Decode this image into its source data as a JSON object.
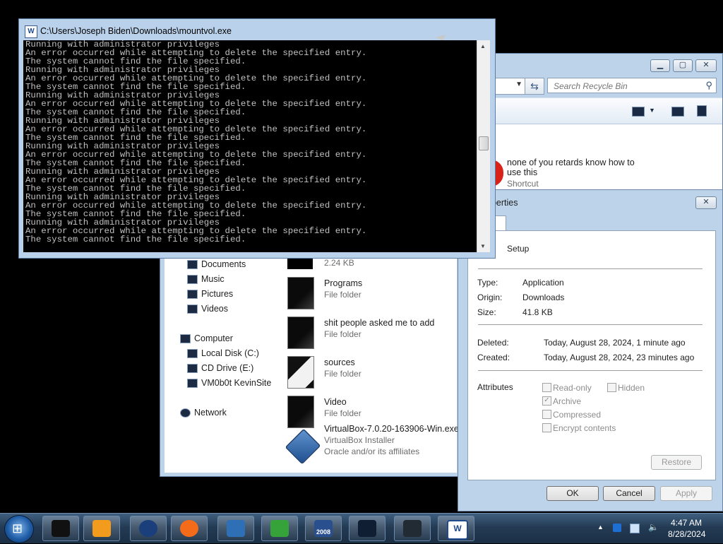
{
  "explorer": {
    "search_placeholder": "Search Recycle Bin",
    "shortcut": {
      "name_line1": "none of you retards know how to",
      "name_line2": "use this",
      "type": "Shortcut"
    },
    "nav": [
      {
        "label": "Documents"
      },
      {
        "label": "Music"
      },
      {
        "label": "Pictures"
      },
      {
        "label": "Videos"
      },
      {
        "label": "Computer"
      },
      {
        "label": "Local Disk (C:)"
      },
      {
        "label": "CD Drive (E:)"
      },
      {
        "label": "VM0b0t KevinSite"
      },
      {
        "label": "Network"
      }
    ],
    "files": [
      {
        "name": "",
        "sub": "2.24 KB"
      },
      {
        "name": "Programs",
        "sub": "File folder"
      },
      {
        "name": "shit people asked me to add",
        "sub": "File folder"
      },
      {
        "name": "sources",
        "sub": "File folder"
      },
      {
        "name": "Video",
        "sub": "File folder"
      },
      {
        "name": "VirtualBox-7.0.20-163906-Win.exe",
        "sub": "VirtualBox Installer",
        "sub2": "Oracle and/or its affiliates"
      }
    ]
  },
  "props": {
    "title": "operties",
    "tab": "al",
    "name": "Setup",
    "type_label": "Type:",
    "type_value": "Application",
    "origin_label": "Origin:",
    "origin_value": "Downloads",
    "size_label": "Size:",
    "size_value": "41.8 KB",
    "deleted_label": "Deleted:",
    "deleted_value": "Today, August 28, 2024, 1 minute ago",
    "created_label": "Created:",
    "created_value": "Today, August 28, 2024, 23 minutes ago",
    "attributes_label": "Attributes",
    "attrs": {
      "readonly": "Read-only",
      "hidden": "Hidden",
      "archive": "Archive",
      "compressed": "Compressed",
      "encrypt": "Encrypt contents"
    },
    "restore": "Restore",
    "ok": "OK",
    "cancel": "Cancel",
    "apply": "Apply"
  },
  "console": {
    "title": "C:\\Users\\Joseph Biden\\Downloads\\mountvol.exe",
    "lines": [
      "Running with administrator privileges",
      "An error occurred while attempting to delete the specified entry.",
      "The system cannot find the file specified.",
      "Running with administrator privileges",
      "An error occurred while attempting to delete the specified entry.",
      "The system cannot find the file specified.",
      "Running with administrator privileges",
      "An error occurred while attempting to delete the specified entry.",
      "The system cannot find the file specified.",
      "Running with administrator privileges",
      "An error occurred while attempting to delete the specified entry.",
      "The system cannot find the file specified.",
      "Running with administrator privileges",
      "An error occurred while attempting to delete the specified entry.",
      "The system cannot find the file specified.",
      "Running with administrator privileges",
      "An error occurred while attempting to delete the specified entry.",
      "The system cannot find the file specified.",
      "Running with administrator privileges",
      "An error occurred while attempting to delete the specified entry.",
      "The system cannot find the file specified.",
      "Running with administrator privileges",
      "An error occurred while attempting to delete the specified entry.",
      "The system cannot find the file specified."
    ]
  },
  "taskbar": {
    "items": [
      {
        "icon": "terminal-icon",
        "color": "#111111"
      },
      {
        "icon": "media-player-icon",
        "color": "#f29b1d"
      },
      {
        "icon": "globe-icon",
        "color": "#1b3f7a"
      },
      {
        "icon": "firefox-icon",
        "color": "#f46b1a"
      },
      {
        "icon": "virtualbox-icon",
        "color": "#2f6fb5"
      },
      {
        "icon": "download-manager-icon",
        "color": "#36a23a"
      },
      {
        "icon": "calendar-2008-icon",
        "color": "#2a4f8f"
      },
      {
        "icon": "monitor-graph-icon",
        "color": "#0f1e33"
      },
      {
        "icon": "drive-icon",
        "color": "#222a33"
      },
      {
        "icon": "word-icon",
        "color": "#ffffff"
      }
    ],
    "calendar_badge": "2008",
    "time": "4:47 AM",
    "date": "8/28/2024"
  }
}
